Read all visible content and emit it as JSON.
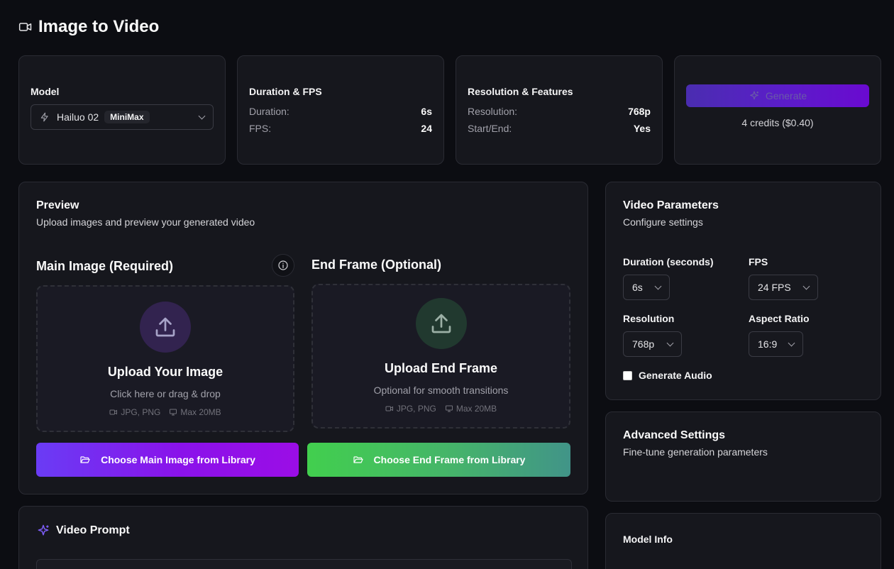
{
  "page": {
    "title": "Image to Video"
  },
  "model_card": {
    "label": "Model",
    "model_name": "Hailuo 02",
    "provider_badge": "MiniMax"
  },
  "duration_card": {
    "label": "Duration & FPS",
    "duration_key": "Duration:",
    "duration_value": "6s",
    "fps_key": "FPS:",
    "fps_value": "24"
  },
  "resolution_card": {
    "label": "Resolution & Features",
    "resolution_key": "Resolution:",
    "resolution_value": "768p",
    "startend_key": "Start/End:",
    "startend_value": "Yes"
  },
  "generate_card": {
    "button_label": "Generate",
    "credits": "4 credits ($0.40)"
  },
  "preview": {
    "title": "Preview",
    "subtitle": "Upload images and preview your generated video",
    "main_image": {
      "heading": "Main Image (Required)",
      "upload_title": "Upload Your Image",
      "upload_hint": "Click here or drag & drop",
      "formats": "JPG, PNG",
      "max_size": "Max 20MB",
      "library_button": "Choose Main Image from Library"
    },
    "end_frame": {
      "heading": "End Frame (Optional)",
      "upload_title": "Upload End Frame",
      "upload_hint": "Optional for smooth transitions",
      "formats": "JPG, PNG",
      "max_size": "Max 20MB",
      "library_button": "Choose End Frame from Library"
    }
  },
  "video_prompt": {
    "title": "Video Prompt"
  },
  "video_parameters": {
    "title": "Video Parameters",
    "subtitle": "Configure settings",
    "duration_label": "Duration (seconds)",
    "duration_value": "6s",
    "fps_label": "FPS",
    "fps_value": "24 FPS",
    "resolution_label": "Resolution",
    "resolution_value": "768p",
    "aspect_label": "Aspect Ratio",
    "aspect_value": "16:9",
    "audio_label": "Generate Audio",
    "audio_checked": false
  },
  "advanced_settings": {
    "title": "Advanced Settings",
    "subtitle": "Fine-tune generation parameters"
  },
  "model_info": {
    "title": "Model Info"
  },
  "colors": {
    "background": "#0c0d12",
    "card": "#16171d",
    "purple_gradient_start": "#6a3cf5",
    "purple_gradient_end": "#9b0de6",
    "green_gradient_start": "#42cf4e",
    "green_gradient_end": "#419488"
  },
  "icons": {
    "title": "video-camera-icon",
    "model": "lightning-icon",
    "generate": "sparkles-icon",
    "upload": "upload-icon",
    "info": "info-icon",
    "folder": "folder-open-icon",
    "prompt": "sparkles-icon",
    "formats": "video-icon",
    "size": "monitor-icon"
  }
}
